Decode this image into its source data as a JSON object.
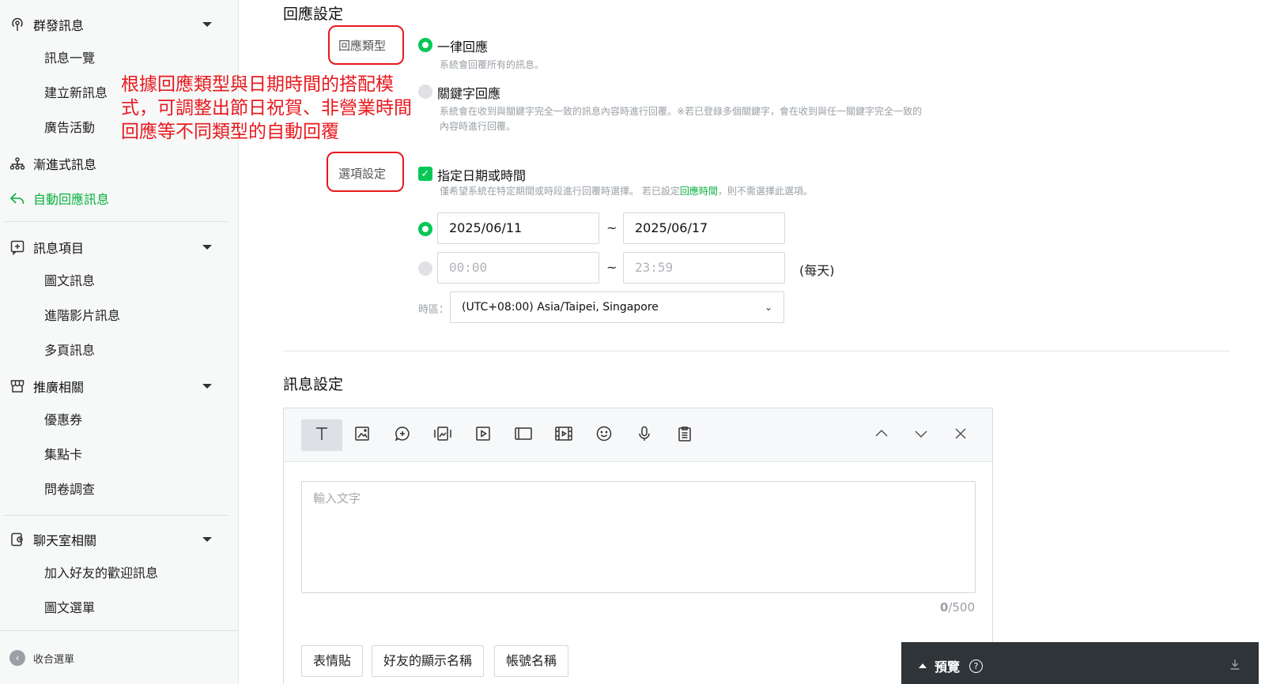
{
  "sidebar": {
    "groups": [
      {
        "label": "群發訊息",
        "icon": "broadcast-icon"
      },
      {
        "label": "漸進式訊息",
        "icon": "hierarchy-icon"
      },
      {
        "label": "自動回應訊息",
        "icon": "reply-icon"
      },
      {
        "label": "訊息項目",
        "icon": "add-message-icon"
      },
      {
        "label": "推廣相關",
        "icon": "store-icon"
      },
      {
        "label": "聊天室相關",
        "icon": "chat-room-icon"
      }
    ],
    "subitems": {
      "broadcast": [
        "訊息一覽",
        "建立新訊息",
        "廣告活動"
      ],
      "message_items": [
        "圖文訊息",
        "進階影片訊息",
        "多頁訊息"
      ],
      "promotion": [
        "優惠券",
        "集點卡",
        "問卷調查"
      ],
      "chat": [
        "加入好友的歡迎訊息",
        "圖文選單"
      ]
    },
    "collapse_label": "收合選單"
  },
  "reply_settings": {
    "title": "回應設定",
    "type_label": "回應類型",
    "option_all": "一律回應",
    "option_all_desc": "系統會回覆所有的訊息。",
    "option_keyword": "關鍵字回應",
    "option_keyword_desc_1": "系統會在收到與關鍵字完全一致的訊息內容時進行回覆。※若已登錄多個關鍵字，會在收到與任一關鍵字完全一致的",
    "option_keyword_desc_2": "內容時進行回覆。",
    "options_label": "選項設定",
    "date_checkbox_label": "指定日期或時間",
    "date_desc_pre": "僅希望系統在特定期間或時段進行回覆時選擇。 若已設定",
    "date_desc_link": "回應時間",
    "date_desc_post": "，則不需選擇此選項。",
    "date_start": "2025/06/11",
    "date_end": "2025/06/17",
    "time_start": "00:00",
    "time_end": "23:59",
    "tilde": "~",
    "each_day": "(每天)",
    "tz_label": "時區：",
    "tz_value": "(UTC+08:00) Asia/Taipei, Singapore"
  },
  "annotation": "根據回應類型與日期時間的搭配模式，可調整出節日祝賀、非營業時間回應等不同類型的自動回覆",
  "message_settings": {
    "title": "訊息設定",
    "placeholder": "輸入文字",
    "count_current": "0",
    "count_max": "/500",
    "chips": [
      "表情貼",
      "好友的顯示名稱",
      "帳號名稱"
    ]
  },
  "preview": {
    "label": "預覽",
    "help": "?"
  },
  "colors": {
    "accent": "#06c755",
    "annotation": "#e8191e",
    "preview_bg": "#2f3438"
  }
}
